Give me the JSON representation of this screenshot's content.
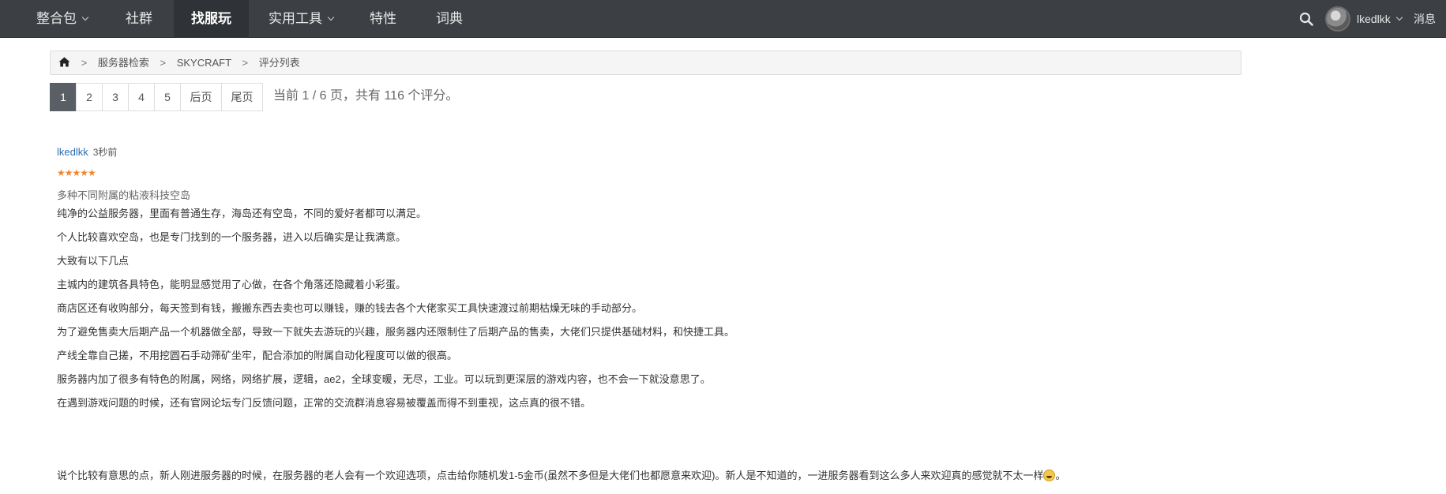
{
  "nav": {
    "items": [
      {
        "label": "整合包",
        "has_caret": true,
        "active": false
      },
      {
        "label": "社群",
        "has_caret": false,
        "active": false
      },
      {
        "label": "找服玩",
        "has_caret": false,
        "active": true
      },
      {
        "label": "实用工具",
        "has_caret": true,
        "active": false
      },
      {
        "label": "特性",
        "has_caret": false,
        "active": false
      },
      {
        "label": "词典",
        "has_caret": false,
        "active": false
      }
    ],
    "username": "lkedlkk",
    "messages_label": "消息",
    "messages_count": "0",
    "colors": {
      "bar": "#3c3f44",
      "active": "#2f3236"
    }
  },
  "breadcrumb": {
    "home_icon": "home-icon",
    "items": [
      "服务器检索",
      "SKYCRAFT",
      "评分列表"
    ],
    "separator": ">"
  },
  "pagination": {
    "pages": [
      "1",
      "2",
      "3",
      "4",
      "5"
    ],
    "current": "1",
    "next_label": "后页",
    "last_label": "尾页",
    "info": "当前 1 / 6 页，共有 116 个评分。"
  },
  "review": {
    "author": "lkedlkk",
    "time": "3秒前",
    "rating": 5,
    "stars": "★★★★★",
    "title": "多种不同附属的粘液科技空岛",
    "paragraphs": [
      "纯净的公益服务器，里面有普通生存，海岛还有空岛，不同的爱好者都可以满足。",
      "个人比较喜欢空岛，也是专门找到的一个服务器，进入以后确实是让我满意。",
      "大致有以下几点",
      "主城内的建筑各具特色，能明显感觉用了心做，在各个角落还隐藏着小彩蛋。",
      "商店区还有收购部分，每天签到有钱，搬搬东西去卖也可以赚钱，赚的钱去各个大佬家买工具快速渡过前期枯燥无味的手动部分。",
      "为了避免售卖大后期产品一个机器做全部，导致一下就失去游玩的兴趣，服务器内还限制住了后期产品的售卖，大佬们只提供基础材料，和快捷工具。",
      "产线全靠自己搓，不用挖圆石手动筛矿坐牢，配合添加的附属自动化程度可以做的很高。",
      "服务器内加了很多有特色的附属，网络，网络扩展，逻辑，ae2，全球变暖，无尽，工业。可以玩到更深层的游戏内容，也不会一下就没意思了。",
      "在遇到游戏问题的时候，还有官网论坛专门反馈问题，正常的交流群消息容易被覆盖而得不到重视，这点真的很不错。",
      "说个比较有意思的点，新人刚进服务器的时候，在服务器的老人会有一个欢迎选项，点击给你随机发1-5金币(虽然不多但是大佬们也都愿意来欢迎)。新人是不知道的，一进服务器看到这么多人来欢迎真的感觉就不太一样"
    ],
    "last_emoji": "grinning-emoji-icon",
    "last_suffix": "。"
  }
}
